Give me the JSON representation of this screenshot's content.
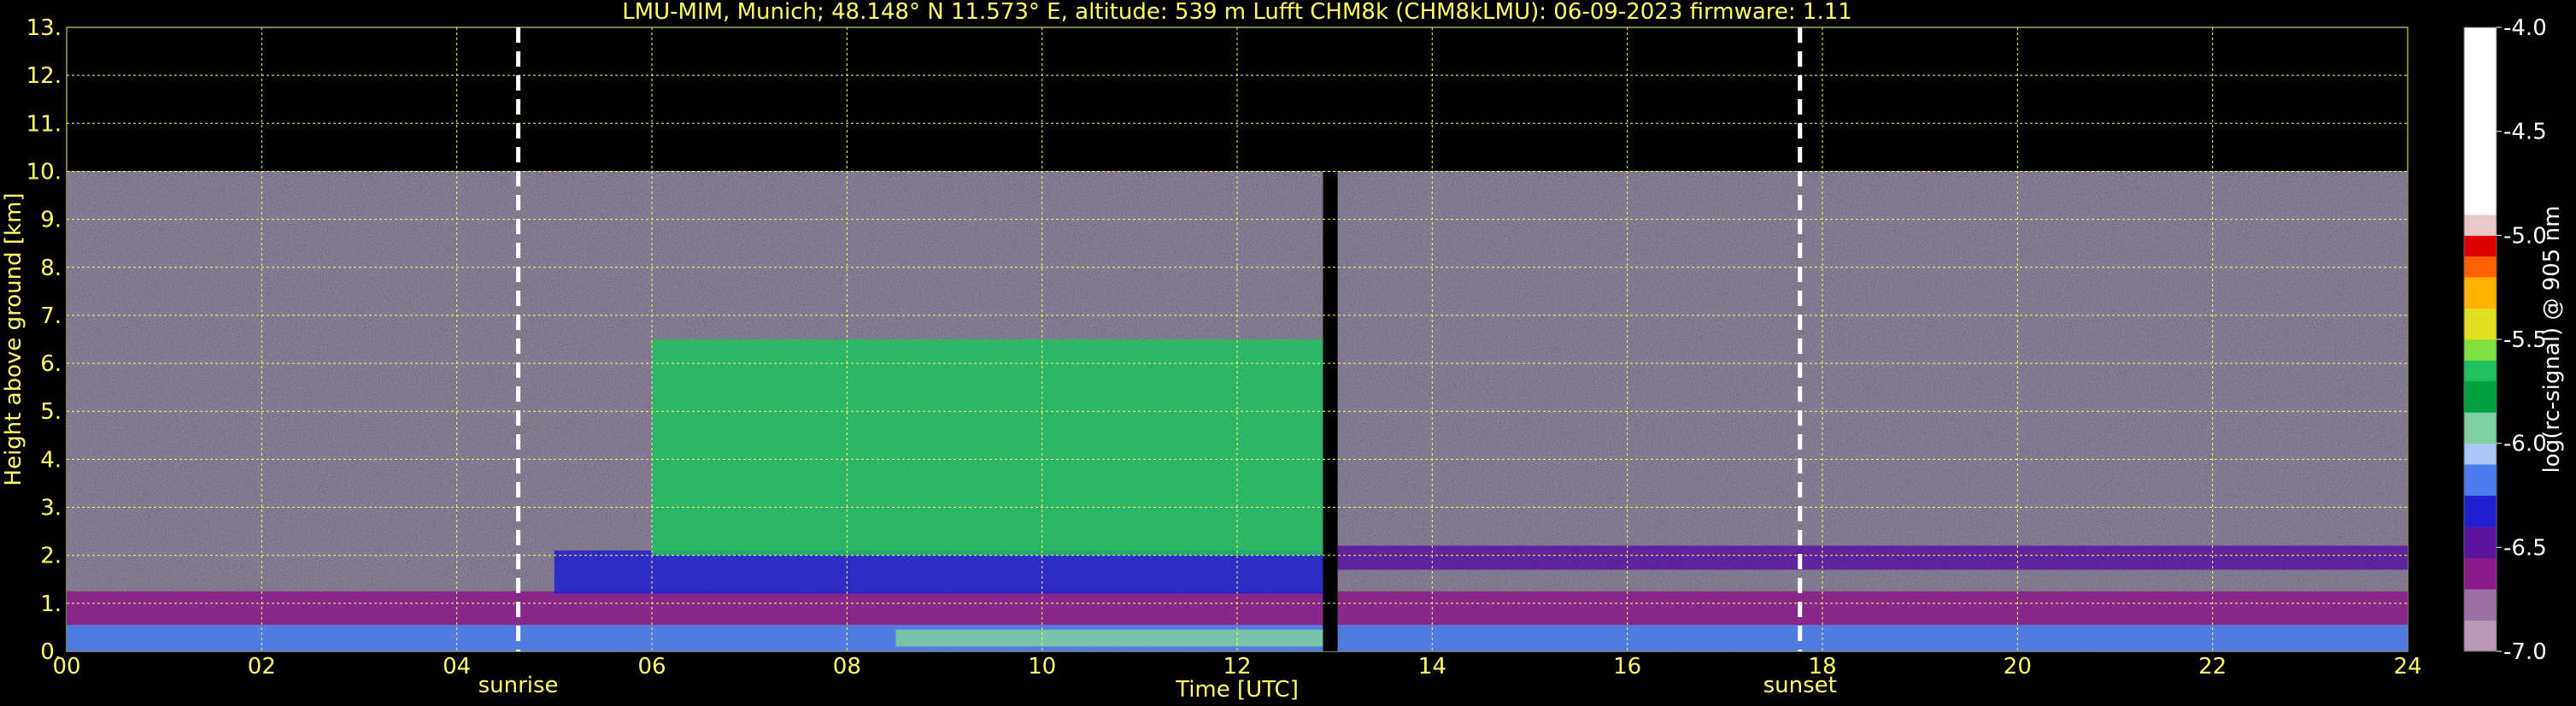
{
  "chart_data": {
    "type": "heatmap",
    "title": "LMU-MIM, Munich; 48.148° N 11.573° E, altitude: 539 m    Lufft CHM8k (CHM8kLMU): 06-09-2023    firmware: 1.11",
    "xlabel": "Time [UTC]",
    "ylabel": "Height above ground [km]",
    "xlim": [
      0,
      24
    ],
    "ylim": [
      0,
      13
    ],
    "x_ticks": [
      "00",
      "02",
      "04",
      "06",
      "08",
      "10",
      "12",
      "14",
      "16",
      "18",
      "20",
      "22",
      "24"
    ],
    "y_ticks": [
      "0.",
      "1.",
      "2.",
      "3.",
      "4.",
      "5.",
      "6.",
      "7.",
      "8.",
      "9.",
      "10.",
      "11.",
      "12.",
      "13."
    ],
    "grid": true,
    "data_top_km": 10,
    "missing_data": [
      12.88,
      13.03
    ],
    "events": [
      {
        "label": "sunrise",
        "time": 4.63
      },
      {
        "label": "sunset",
        "time": 17.77
      }
    ],
    "layers": [
      {
        "start": 0,
        "end": 24,
        "bottom_km": 0.0,
        "top_km": 0.55,
        "level": -6.2
      },
      {
        "start": 0,
        "end": 24,
        "bottom_km": 0.55,
        "top_km": 1.25,
        "level": -6.7
      },
      {
        "start": 8.5,
        "end": 12.9,
        "bottom_km": 0.1,
        "top_km": 0.45,
        "level": -5.9
      },
      {
        "start": 5.0,
        "end": 12.9,
        "bottom_km": 1.2,
        "top_km": 2.1,
        "level": -6.4
      },
      {
        "start": 6.0,
        "end": 12.9,
        "bottom_km": 2.0,
        "top_km": 6.5,
        "level": -5.7
      },
      {
        "start": 13.0,
        "end": 24,
        "bottom_km": 1.7,
        "top_km": 2.2,
        "level": -6.5
      }
    ],
    "colorbar": {
      "label": "log(rc-signal) @ 905 nm",
      "range": [
        -7.0,
        -4.0
      ],
      "ticks": [
        "-4.0",
        "-4.5",
        "-5.0",
        "-5.5",
        "-6.0",
        "-6.5",
        "-7.0"
      ]
    }
  }
}
